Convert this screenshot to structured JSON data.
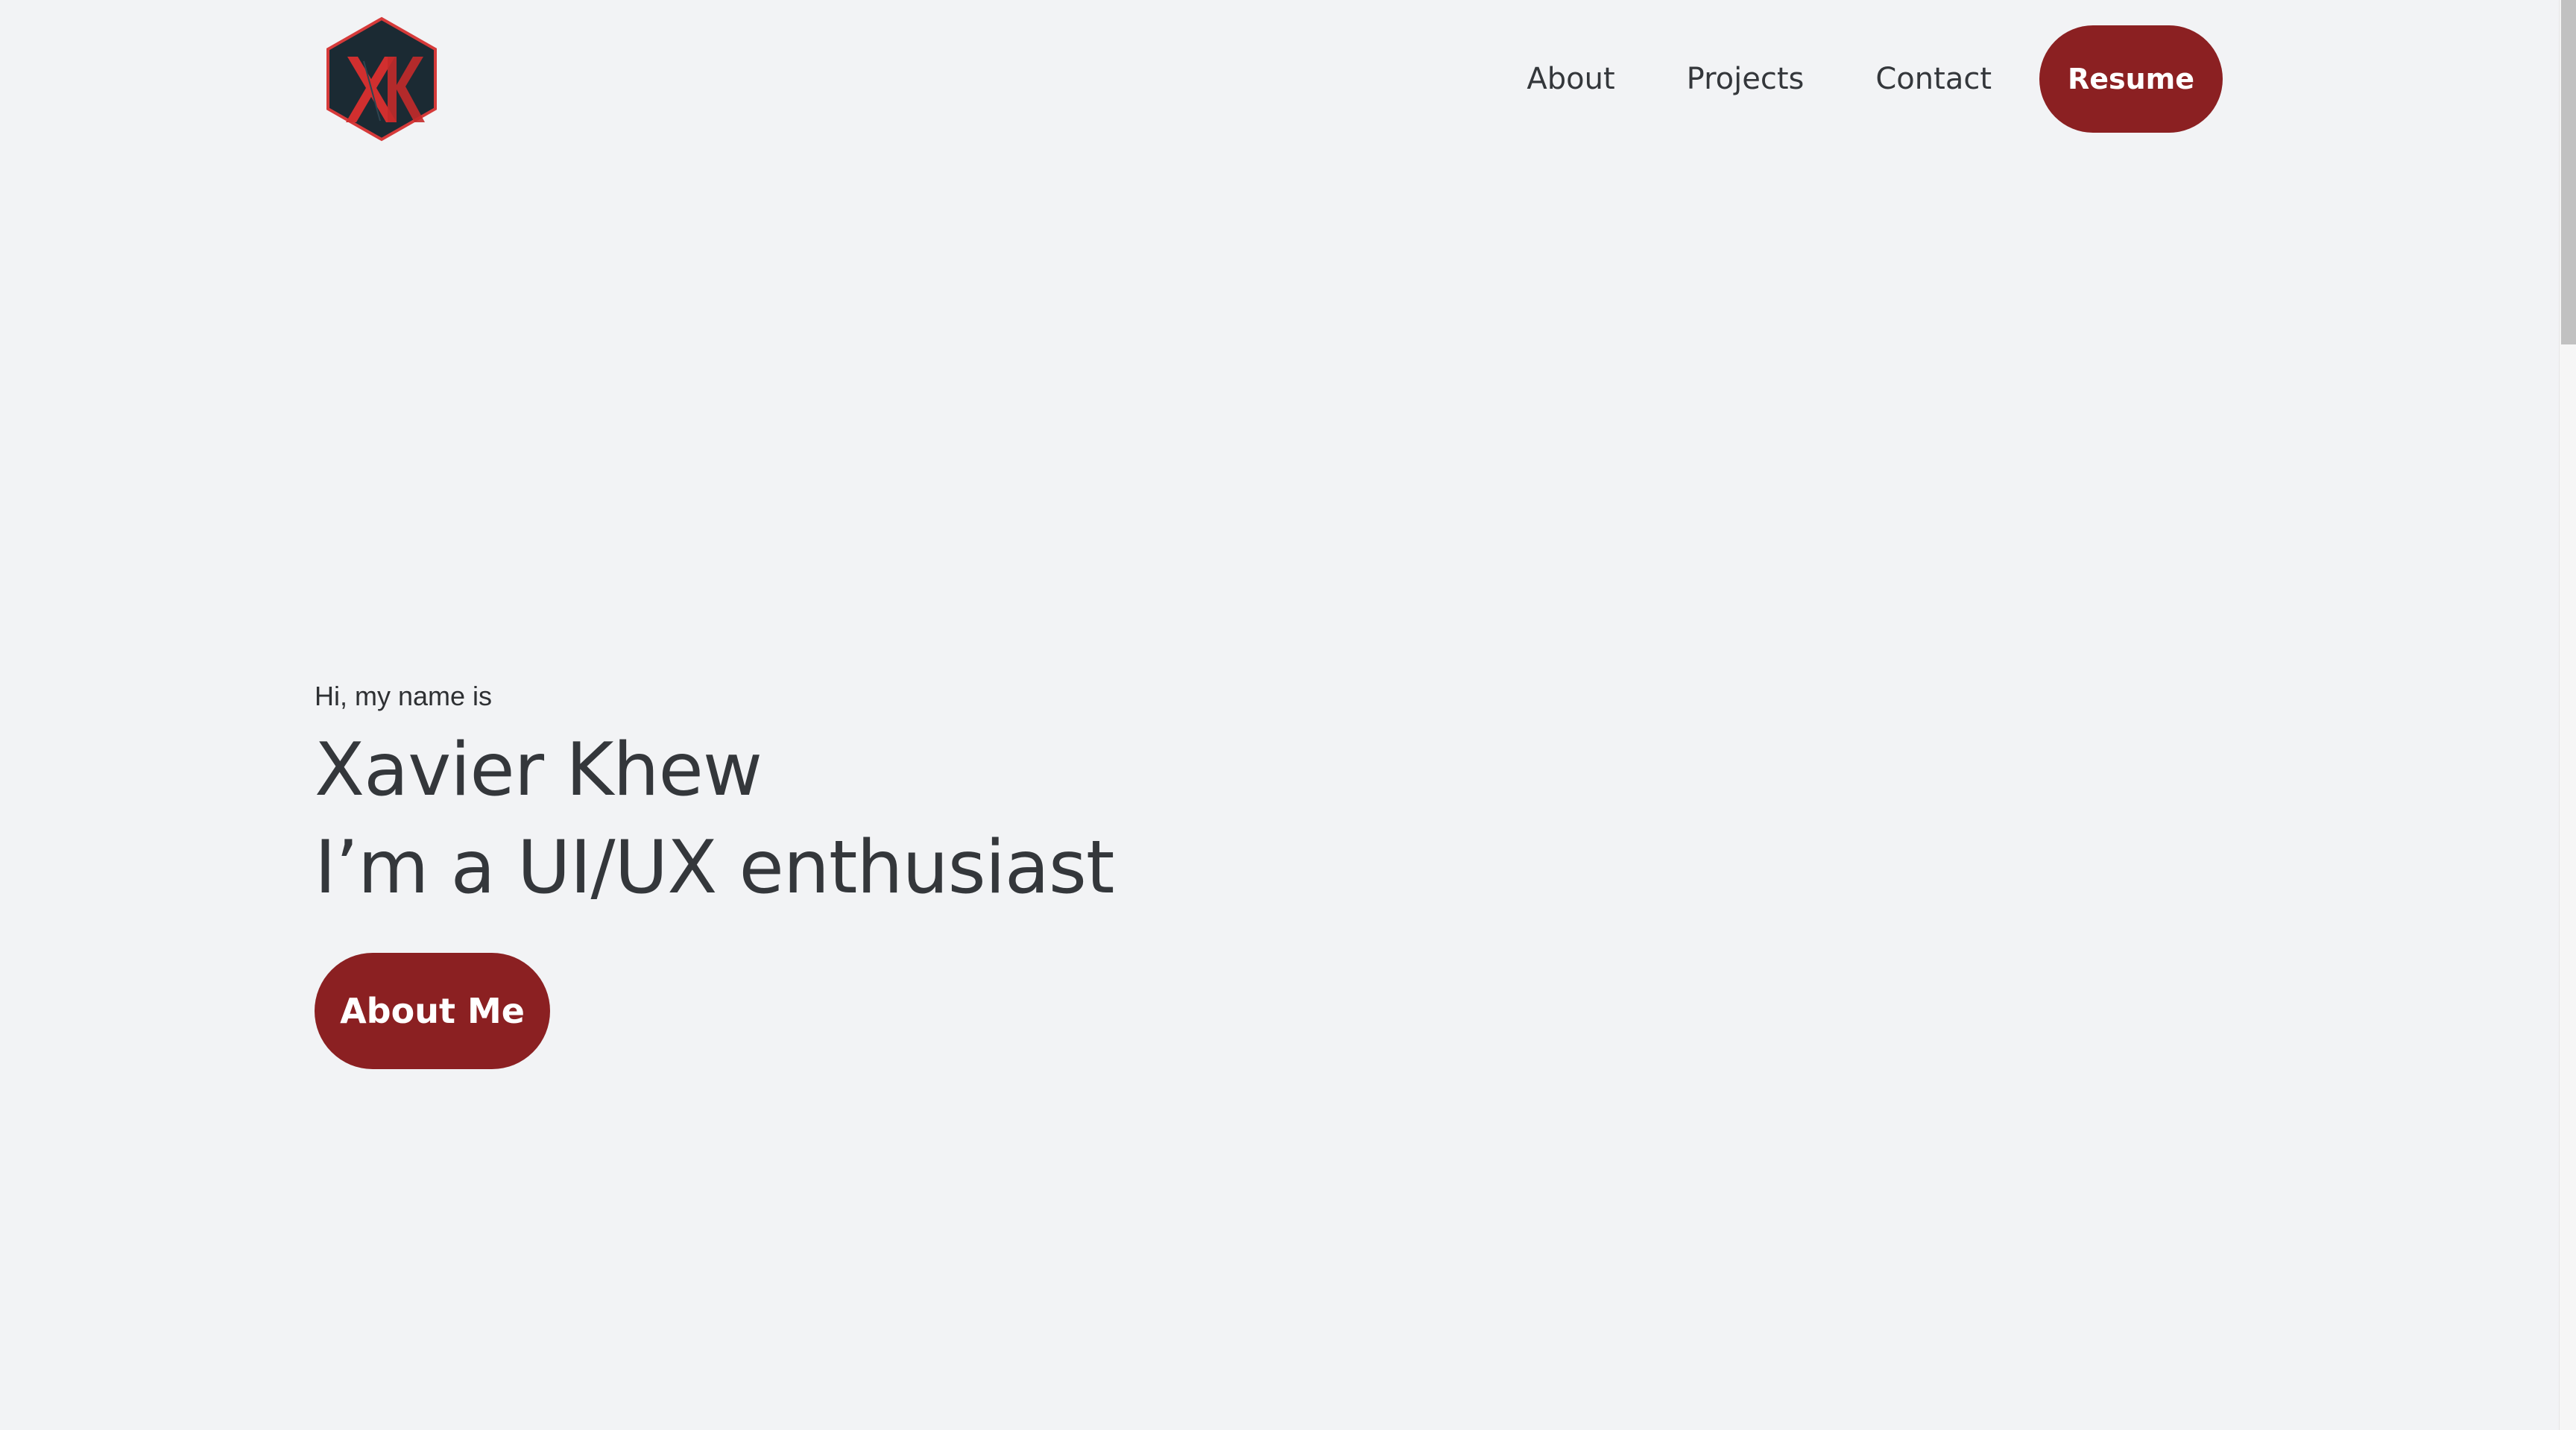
{
  "header": {
    "logo": {
      "icon": "xk-hexagon-logo",
      "text": "XK",
      "colors": {
        "hexagon": "#1b2a33",
        "border": "#d63a3a",
        "letters": "#d12f2f"
      }
    },
    "nav": {
      "about_label": "About",
      "projects_label": "Projects",
      "contact_label": "Contact",
      "resume_label": "Resume"
    }
  },
  "hero": {
    "greeting": "Hi, my name is",
    "name": "Xavier Khew",
    "tagline": "I’m a UI/UX enthusiast",
    "cta_label": "About Me"
  },
  "theme": {
    "background": "#f2f3f5",
    "accent": "#8b2022",
    "text": "#34373b"
  }
}
